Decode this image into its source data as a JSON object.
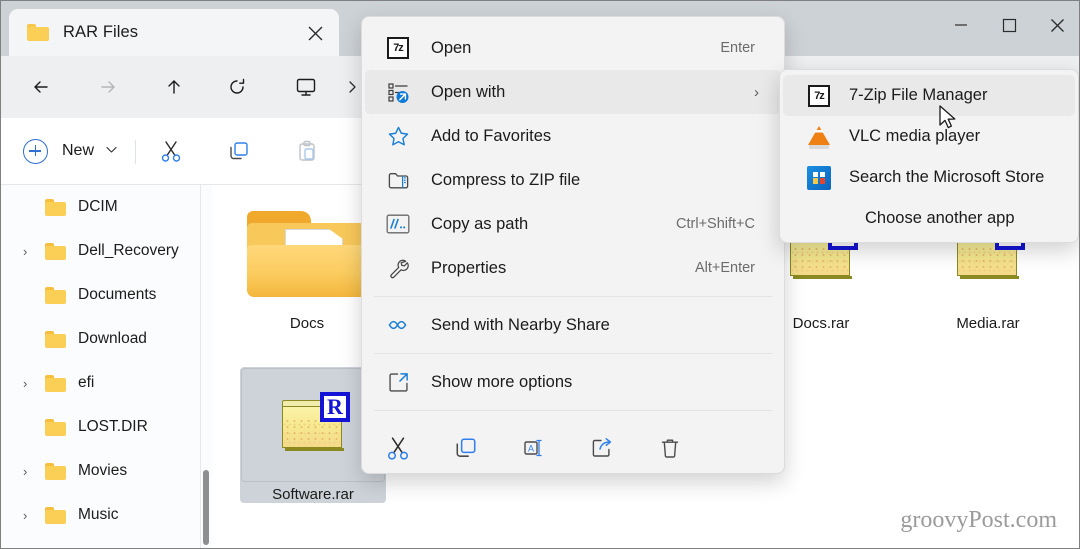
{
  "window": {
    "tab_title": "RAR Files",
    "tab_folder_icon": "folder-icon",
    "close_label": "✕",
    "minimize_label": "minimize-icon",
    "maximize_label": "maximize-icon",
    "window_close_label": "close-icon"
  },
  "navbar": {
    "back": "back-arrow-icon",
    "forward": "forward-arrow-icon",
    "up": "up-arrow-icon",
    "refresh": "refresh-icon",
    "breadcrumb_icon": "this-pc-monitor-icon",
    "breadcrumb_chevron": "›"
  },
  "commandbar": {
    "new_label": "New",
    "new_caret": "⌄",
    "cut_icon": "scissors-icon",
    "copy_icon": "copy-icon",
    "paste_icon": "paste-icon"
  },
  "navpane": {
    "items": [
      {
        "label": "DCIM",
        "expandable": false
      },
      {
        "label": "Dell_Recovery",
        "expandable": true
      },
      {
        "label": "Documents",
        "expandable": false
      },
      {
        "label": "Download",
        "expandable": false
      },
      {
        "label": "efi",
        "expandable": true
      },
      {
        "label": "LOST.DIR",
        "expandable": false
      },
      {
        "label": "Movies",
        "expandable": true
      },
      {
        "label": "Music",
        "expandable": true
      }
    ]
  },
  "files": [
    {
      "name": "Docs",
      "type": "folder",
      "selected": false
    },
    {
      "name": "Software.rar",
      "type": "rar",
      "selected": true
    },
    {
      "name": "Docs.rar",
      "type": "rar",
      "selected": false
    },
    {
      "name": "Media.rar",
      "type": "rar",
      "selected": false
    }
  ],
  "context_menu": {
    "items": [
      {
        "label": "Open",
        "accel": "Enter",
        "icon": "seven-zip-icon",
        "highlight": false,
        "submenu": false
      },
      {
        "label": "Open with",
        "accel": "",
        "icon": "open-with-icon",
        "highlight": true,
        "submenu": true
      },
      {
        "label": "Add to Favorites",
        "accel": "",
        "icon": "star-icon",
        "highlight": false,
        "submenu": false
      },
      {
        "label": "Compress to ZIP file",
        "accel": "",
        "icon": "zip-folder-icon",
        "highlight": false,
        "submenu": false
      },
      {
        "label": "Copy as path",
        "accel": "Ctrl+Shift+C",
        "icon": "copy-path-icon",
        "highlight": false,
        "submenu": false
      },
      {
        "label": "Properties",
        "accel": "Alt+Enter",
        "icon": "wrench-icon",
        "highlight": false,
        "submenu": false
      },
      {
        "label": "Send with Nearby Share",
        "accel": "",
        "icon": "nearby-share-icon",
        "highlight": false,
        "submenu": false
      },
      {
        "label": "Show more options",
        "accel": "",
        "icon": "show-more-options-icon",
        "highlight": false,
        "submenu": false
      }
    ],
    "submenu_chevron": "›",
    "actions": [
      "cut-icon",
      "copy-icon",
      "rename-icon",
      "share-icon",
      "delete-icon"
    ]
  },
  "open_with_submenu": {
    "items": [
      {
        "label": "7-Zip File Manager",
        "icon": "seven-zip-icon",
        "highlight": true
      },
      {
        "label": "VLC media player",
        "icon": "vlc-cone-icon",
        "highlight": false
      },
      {
        "label": "Search the Microsoft Store",
        "icon": "microsoft-store-icon",
        "highlight": false
      },
      {
        "label": "Choose another app",
        "icon": "",
        "highlight": false
      }
    ]
  },
  "watermark": {
    "text": "groovyPost.com"
  },
  "colors": {
    "accent": "#2f6fd0",
    "titlebar_bg": "#cdd2d6",
    "menu_bg": "#f3f3f3",
    "selection_bg": "#cdd3d9",
    "folder_yellow": "#fbce55",
    "rar_blue": "#1414d6"
  }
}
